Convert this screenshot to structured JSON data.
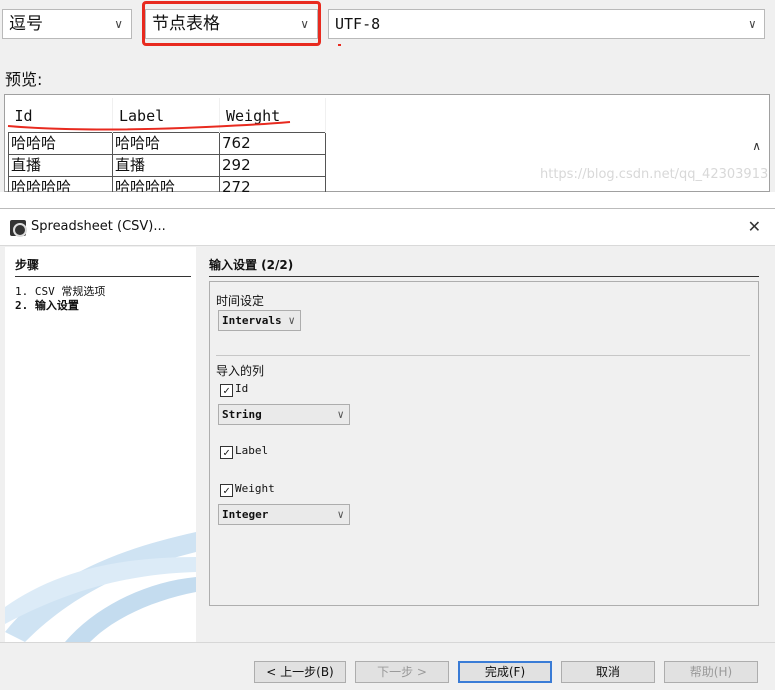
{
  "top": {
    "delimiter_value": "逗号",
    "import_as_value": "节点表格",
    "charset_value": "UTF-8",
    "preview_label": "预览:",
    "columns": [
      "Id",
      "Label",
      "Weight"
    ],
    "rows": [
      [
        "哈哈哈",
        "哈哈哈",
        "762"
      ],
      [
        "直播",
        "直播",
        "292"
      ],
      [
        "哈哈哈哈",
        "哈哈哈哈",
        "272"
      ]
    ],
    "watermark": "https://blog.csdn.net/qq_42303913",
    "annotation_color": "#e82a1f"
  },
  "dialog": {
    "title": "Spreadsheet (CSV)...",
    "steps_header": "步骤",
    "steps": [
      "1.  CSV 常规选项",
      "2.  输入设置"
    ],
    "content_header": "输入设置 (2/2)",
    "time_label": "时间设定",
    "time_value": "Intervals",
    "columns_label": "导入的列",
    "cols": [
      {
        "name": "Id",
        "checked": true,
        "type": "String"
      },
      {
        "name": "Label",
        "checked": true
      },
      {
        "name": "Weight",
        "checked": true,
        "type": "Integer"
      }
    ],
    "buttons": {
      "back": "< 上一步(B)",
      "next": "下一步 >",
      "finish": "完成(F)",
      "cancel": "取消",
      "help": "帮助(H)"
    }
  }
}
